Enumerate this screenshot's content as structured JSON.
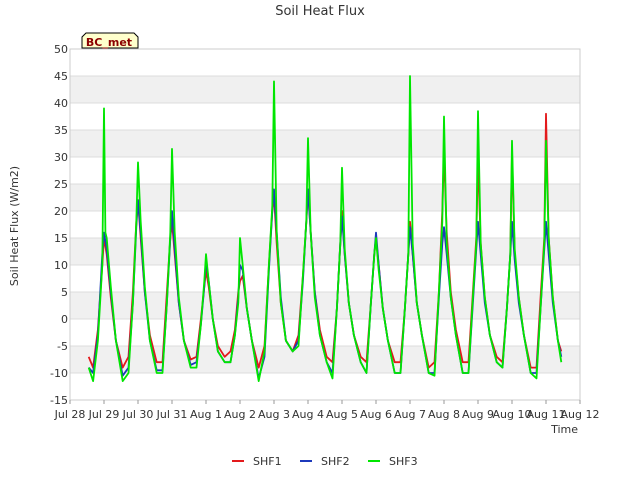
{
  "chart_data": {
    "type": "line",
    "title": "Soil Heat Flux",
    "xlabel": "Time",
    "ylabel": "Soil Heat Flux (W/m2)",
    "site_badge": "BC_met",
    "ylim": [
      -15,
      50
    ],
    "yticks": [
      -15,
      -10,
      -5,
      0,
      5,
      10,
      15,
      20,
      25,
      30,
      35,
      40,
      45,
      50
    ],
    "xlim_days": [
      0,
      15
    ],
    "xticks": [
      {
        "label": "Jul 28",
        "day": 0
      },
      {
        "label": "Jul 29",
        "day": 1
      },
      {
        "label": "Jul 30",
        "day": 2
      },
      {
        "label": "Jul 31",
        "day": 3
      },
      {
        "label": "Aug 1",
        "day": 4
      },
      {
        "label": "Aug 2",
        "day": 5
      },
      {
        "label": "Aug 3",
        "day": 6
      },
      {
        "label": "Aug 4",
        "day": 7
      },
      {
        "label": "Aug 5",
        "day": 8
      },
      {
        "label": "Aug 6",
        "day": 9
      },
      {
        "label": "Aug 7",
        "day": 10
      },
      {
        "label": "Aug 8",
        "day": 11
      },
      {
        "label": "Aug 9",
        "day": 12
      },
      {
        "label": "Aug 10",
        "day": 13
      },
      {
        "label": "Aug 11",
        "day": 14
      },
      {
        "label": "Aug 12",
        "day": 15
      }
    ],
    "grid": true,
    "legend_position": "bottom-center",
    "x_axis_note": "x values are days after the Jul 28 tick",
    "series": [
      {
        "name": "SHF1",
        "color": "#e31a1c",
        "x": [
          0.55,
          0.68,
          0.82,
          0.95,
          1.0,
          1.08,
          1.2,
          1.35,
          1.55,
          1.72,
          1.85,
          1.95,
          2.0,
          2.08,
          2.2,
          2.35,
          2.55,
          2.72,
          2.85,
          2.95,
          3.0,
          3.08,
          3.2,
          3.35,
          3.55,
          3.72,
          3.85,
          3.95,
          4.0,
          4.08,
          4.2,
          4.35,
          4.55,
          4.72,
          4.85,
          4.95,
          5.0,
          5.08,
          5.2,
          5.35,
          5.55,
          5.72,
          5.85,
          5.95,
          6.0,
          6.08,
          6.2,
          6.35,
          6.55,
          6.72,
          6.85,
          6.95,
          7.0,
          7.08,
          7.2,
          7.35,
          7.55,
          7.72,
          7.85,
          7.95,
          8.0,
          8.08,
          8.2,
          8.35,
          8.55,
          8.72,
          8.85,
          8.95,
          9.0,
          9.08,
          9.2,
          9.35,
          9.55,
          9.72,
          9.85,
          9.95,
          10.0,
          10.08,
          10.2,
          10.35,
          10.55,
          10.72,
          10.85,
          10.95,
          11.0,
          11.08,
          11.2,
          11.35,
          11.55,
          11.72,
          11.85,
          11.95,
          12.0,
          12.08,
          12.2,
          12.35,
          12.55,
          12.72,
          12.85,
          12.95,
          13.0,
          13.08,
          13.2,
          13.35,
          13.55,
          13.72,
          13.85,
          13.95,
          14.0,
          14.08,
          14.2,
          14.35,
          14.45
        ],
        "y": [
          -7,
          -9,
          -2,
          10,
          15,
          12,
          4,
          -4,
          -9,
          -7,
          5,
          18,
          22,
          15,
          5,
          -3,
          -8,
          -8,
          5,
          15,
          18,
          12,
          3,
          -4,
          -7.5,
          -7,
          0,
          6,
          9,
          6,
          0,
          -5,
          -7,
          -6,
          -2,
          5,
          7,
          8,
          2,
          -4,
          -9,
          -5,
          10,
          20,
          23,
          14,
          3,
          -4,
          -6,
          -3,
          8,
          18,
          24,
          16,
          5,
          -2,
          -7,
          -8,
          2,
          14,
          20,
          12,
          3,
          -3,
          -7,
          -8,
          3,
          12,
          15,
          10,
          2,
          -4,
          -8,
          -8,
          2,
          12,
          18,
          12,
          3,
          -3,
          -9,
          -8,
          5,
          20,
          31,
          16,
          5,
          -2,
          -8,
          -8,
          5,
          15,
          30,
          14,
          4,
          -3,
          -7,
          -8,
          2,
          12,
          31,
          12,
          4,
          -3,
          -9,
          -9,
          5,
          15,
          38,
          15,
          4,
          -4,
          -6
        ]
      },
      {
        "name": "SHF2",
        "color": "#1c39bb",
        "x": [
          0.55,
          0.68,
          0.82,
          0.95,
          1.0,
          1.08,
          1.2,
          1.35,
          1.55,
          1.72,
          1.85,
          1.95,
          2.0,
          2.08,
          2.2,
          2.35,
          2.55,
          2.72,
          2.85,
          2.95,
          3.0,
          3.08,
          3.2,
          3.35,
          3.55,
          3.72,
          3.85,
          3.95,
          4.0,
          4.08,
          4.2,
          4.35,
          4.55,
          4.72,
          4.85,
          4.95,
          5.0,
          5.08,
          5.2,
          5.35,
          5.55,
          5.72,
          5.85,
          5.95,
          6.0,
          6.08,
          6.2,
          6.35,
          6.55,
          6.72,
          6.85,
          6.95,
          7.0,
          7.08,
          7.2,
          7.35,
          7.55,
          7.72,
          7.85,
          7.95,
          8.0,
          8.08,
          8.2,
          8.35,
          8.55,
          8.72,
          8.85,
          8.95,
          9.0,
          9.08,
          9.2,
          9.35,
          9.55,
          9.72,
          9.85,
          9.95,
          10.0,
          10.08,
          10.2,
          10.35,
          10.55,
          10.72,
          10.85,
          10.95,
          11.0,
          11.08,
          11.2,
          11.35,
          11.55,
          11.72,
          11.85,
          11.95,
          12.0,
          12.08,
          12.2,
          12.35,
          12.55,
          12.72,
          12.85,
          12.95,
          13.0,
          13.08,
          13.2,
          13.35,
          13.55,
          13.72,
          13.85,
          13.95,
          14.0,
          14.08,
          14.2,
          14.35,
          14.45
        ],
        "y": [
          -9,
          -10,
          -3,
          12,
          16,
          13,
          5,
          -4,
          -10.5,
          -9,
          3,
          17,
          22,
          16,
          5,
          -4,
          -9.5,
          -9.5,
          3,
          15,
          20,
          13,
          3,
          -4,
          -8.5,
          -8,
          -1,
          6,
          11,
          7,
          0,
          -6,
          -8,
          -8,
          -3,
          4,
          10,
          9,
          2,
          -4,
          -11,
          -7,
          9,
          20,
          24,
          16,
          4,
          -4,
          -6,
          -4,
          7,
          18,
          24,
          16,
          5,
          -3,
          -8,
          -10,
          2,
          14,
          19,
          12,
          3,
          -3,
          -8,
          -10,
          3,
          12,
          16,
          10,
          2,
          -4,
          -10,
          -10,
          2,
          12,
          17,
          12,
          3,
          -3,
          -10,
          -10,
          4,
          14,
          17,
          12,
          4,
          -3,
          -10,
          -10,
          3,
          13,
          18,
          12,
          3,
          -3,
          -8,
          -9,
          2,
          12,
          18,
          11,
          3,
          -3,
          -10,
          -10,
          3,
          13,
          18,
          12,
          3,
          -4,
          -7
        ]
      },
      {
        "name": "SHF3",
        "color": "#00e600",
        "x": [
          0.55,
          0.68,
          0.82,
          0.95,
          1.0,
          1.04,
          1.08,
          1.2,
          1.35,
          1.55,
          1.72,
          1.85,
          1.95,
          2.0,
          2.08,
          2.2,
          2.35,
          2.55,
          2.72,
          2.85,
          2.95,
          3.0,
          3.08,
          3.2,
          3.35,
          3.55,
          3.72,
          3.85,
          3.95,
          4.0,
          4.08,
          4.2,
          4.35,
          4.55,
          4.72,
          4.85,
          4.95,
          5.0,
          5.08,
          5.2,
          5.35,
          5.55,
          5.72,
          5.85,
          5.95,
          6.0,
          6.08,
          6.2,
          6.35,
          6.55,
          6.72,
          6.85,
          6.95,
          7.0,
          7.08,
          7.2,
          7.35,
          7.55,
          7.72,
          7.85,
          7.95,
          8.0,
          8.08,
          8.2,
          8.35,
          8.55,
          8.72,
          8.85,
          8.95,
          9.0,
          9.08,
          9.2,
          9.35,
          9.55,
          9.72,
          9.85,
          9.95,
          10.0,
          10.08,
          10.2,
          10.35,
          10.55,
          10.72,
          10.85,
          10.95,
          11.0,
          11.08,
          11.2,
          11.35,
          11.55,
          11.72,
          11.85,
          11.95,
          12.0,
          12.08,
          12.2,
          12.35,
          12.55,
          12.72,
          12.85,
          12.95,
          13.0,
          13.08,
          13.2,
          13.35,
          13.55,
          13.72,
          13.85,
          13.95,
          14.0,
          14.08,
          14.2,
          14.35,
          14.45
        ],
        "y": [
          -9,
          -11.5,
          -4,
          10,
          39,
          16,
          15,
          6,
          -4,
          -11.5,
          -10,
          3,
          18,
          29,
          18,
          6,
          -4,
          -10,
          -10,
          3,
          16,
          31.5,
          16,
          4,
          -4,
          -9,
          -9,
          -1,
          7,
          12,
          7,
          0,
          -6,
          -8,
          -8,
          -3,
          3,
          15,
          10,
          2,
          -4,
          -11.5,
          -6,
          10,
          21,
          44,
          16,
          3,
          -4,
          -6,
          -5,
          8,
          18,
          33.5,
          16,
          4,
          -3,
          -8,
          -11,
          2,
          14,
          28,
          13,
          3,
          -3,
          -8,
          -10,
          3,
          12,
          15,
          9,
          2,
          -4,
          -10,
          -10,
          2,
          12,
          45,
          14,
          3,
          -3,
          -10,
          -10.5,
          5,
          18,
          37.5,
          14,
          4,
          -3,
          -10,
          -10,
          4,
          14,
          38.5,
          14,
          4,
          -3,
          -8,
          -9,
          2,
          12,
          33,
          13,
          4,
          -3,
          -10,
          -11,
          3,
          14,
          33,
          15,
          4,
          -4,
          -8
        ]
      }
    ]
  }
}
